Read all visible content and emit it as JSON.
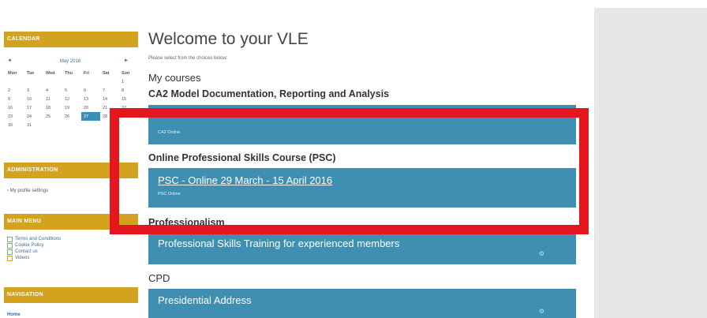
{
  "calendar": {
    "header": "CALENDAR",
    "prev": "◄",
    "next": "►",
    "month": "May 2016",
    "days": [
      "Mon",
      "Tue",
      "Wed",
      "Thu",
      "Fri",
      "Sat",
      "Sun"
    ],
    "weeks": [
      [
        "",
        "",
        "",
        "",
        "",
        "",
        "1"
      ],
      [
        "2",
        "3",
        "4",
        "5",
        "6",
        "7",
        "8"
      ],
      [
        "9",
        "10",
        "11",
        "12",
        "13",
        "14",
        "15"
      ],
      [
        "16",
        "17",
        "18",
        "19",
        "20",
        "21",
        "22"
      ],
      [
        "23",
        "24",
        "25",
        "26",
        "27",
        "28",
        "29"
      ],
      [
        "30",
        "31",
        "",
        "",
        "",
        "",
        ""
      ]
    ],
    "today": "27"
  },
  "administration": {
    "header": "ADMINISTRATION",
    "item": "My profile settings"
  },
  "main_menu": {
    "header": "MAIN MENU",
    "items": [
      "Terms and Conditions",
      "Cookie Policy",
      "Contact us",
      "Videos"
    ]
  },
  "navigation": {
    "header": "NAVIGATION",
    "home": "Home"
  },
  "page": {
    "title": "Welcome to your VLE",
    "subtitle": "Please select from the choices below:",
    "my_courses": "My courses"
  },
  "courses": [
    {
      "category": "CA2 Model Documentation, Reporting and Analysis",
      "title": "",
      "sub": "CA2 Online"
    },
    {
      "category": "Online Professional Skills Course (PSC)",
      "title": "PSC - Online 29 March - 15 April 2016",
      "sub": "PSC Online"
    },
    {
      "category": "Professionalism",
      "title": "Professional Skills Training for experienced members",
      "sub": ""
    },
    {
      "category": "CPD",
      "title": "Presidential Address",
      "sub": ""
    }
  ],
  "colors": {
    "accent_gold": "#d3a21e",
    "course_blue": "#3f8fb3",
    "highlight_red": "#e4161f"
  }
}
